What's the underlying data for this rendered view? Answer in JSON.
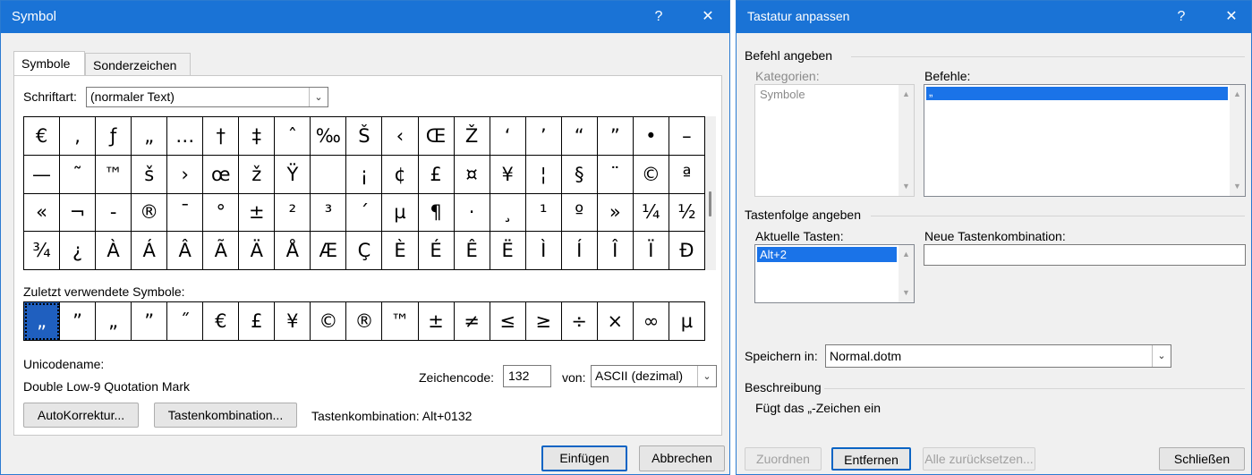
{
  "symbol_dialog": {
    "title": "Symbol",
    "help_glyph": "?",
    "close_glyph": "✕",
    "tabs": [
      {
        "label": "Symbole",
        "active": true
      },
      {
        "label": "Sonderzeichen",
        "active": false
      }
    ],
    "font_label": "Schriftart:",
    "font_value": "(normaler Text)",
    "symbol_grid": [
      [
        "€",
        ",",
        "ƒ",
        "„",
        "…",
        "†",
        "‡",
        "ˆ",
        "‰",
        "Š",
        "‹",
        "Œ",
        "Ž",
        "‘",
        "’",
        "“",
        "”",
        "•",
        "–"
      ],
      [
        "—",
        "˜",
        "™",
        "š",
        "›",
        "œ",
        "ž",
        "Ÿ",
        " ",
        "¡",
        "¢",
        "£",
        "¤",
        "¥",
        "¦",
        "§",
        "¨",
        "©",
        "ª"
      ],
      [
        "«",
        "¬",
        "-",
        "®",
        "¯",
        "°",
        "±",
        "²",
        "³",
        "´",
        "µ",
        "¶",
        "·",
        "¸",
        "¹",
        "º",
        "»",
        "¼",
        "½"
      ],
      [
        "¾",
        "¿",
        "À",
        "Á",
        "Â",
        "Ã",
        "Ä",
        "Å",
        "Æ",
        "Ç",
        "È",
        "É",
        "Ê",
        "Ë",
        "Ì",
        "Í",
        "Î",
        "Ï",
        "Ð"
      ]
    ],
    "recent_label": "Zuletzt verwendete Symbole:",
    "recent_symbols": [
      "„",
      "”",
      "„",
      "”",
      "˝",
      "€",
      "£",
      "¥",
      "©",
      "®",
      "™",
      "±",
      "≠",
      "≤",
      "≥",
      "÷",
      "×",
      "∞",
      "µ"
    ],
    "unicode_name_label": "Unicodename:",
    "unicode_name_value": "Double Low-9 Quotation Mark",
    "charcode_label": "Zeichencode:",
    "charcode_value": "132",
    "from_label": "von:",
    "from_value": "ASCII (dezimal)",
    "autocorrect_button": "AutoKorrektur...",
    "shortcut_button": "Tastenkombination...",
    "shortcut_text": "Tastenkombination: Alt+0132",
    "insert_button": "Einfügen",
    "cancel_button": "Abbrechen"
  },
  "keyboard_dialog": {
    "title": "Tastatur anpassen",
    "help_glyph": "?",
    "close_glyph": "✕",
    "command_group": "Befehl angeben",
    "categories_label": "Kategorien:",
    "categories_items": [
      "Symbole"
    ],
    "commands_label": "Befehle:",
    "commands_items": [
      "„"
    ],
    "keyseq_group": "Tastenfolge angeben",
    "current_keys_label": "Aktuelle Tasten:",
    "current_keys_items": [
      "Alt+2"
    ],
    "new_shortcut_label": "Neue Tastenkombination:",
    "new_shortcut_value": "",
    "save_in_label": "Speichern in:",
    "save_in_value": "Normal.dotm",
    "description_group": "Beschreibung",
    "description_text": "Fügt das „-Zeichen ein",
    "assign_button": "Zuordnen",
    "remove_button": "Entfernen",
    "reset_all_button": "Alle zurücksetzen...",
    "close_button": "Schließen"
  }
}
